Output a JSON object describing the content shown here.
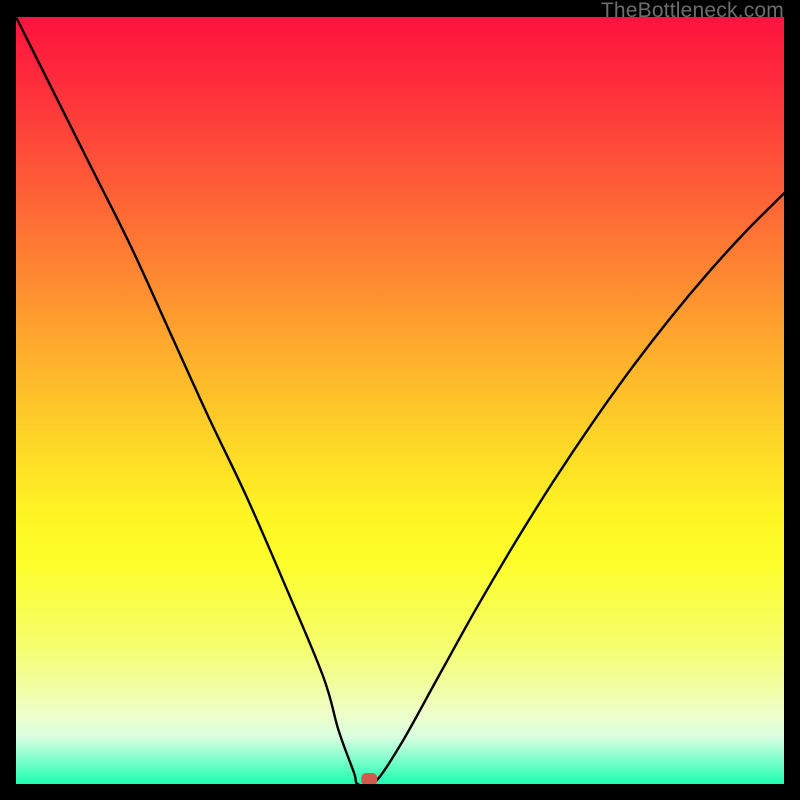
{
  "watermark": "TheBottleneck.com",
  "chart_data": {
    "type": "line",
    "title": "",
    "xlabel": "",
    "ylabel": "",
    "xlim": [
      0,
      100
    ],
    "ylim": [
      0,
      100
    ],
    "grid": false,
    "background": "rainbow-vertical-gradient",
    "series": [
      {
        "name": "bottleneck-curve",
        "color": "#000000",
        "x": [
          0,
          5,
          10,
          15,
          20,
          25,
          30,
          35,
          40,
          42,
          44,
          44.5,
          46.5,
          50,
          55,
          60,
          65,
          70,
          75,
          80,
          85,
          90,
          95,
          100
        ],
        "values": [
          100,
          90,
          80,
          70,
          59,
          48,
          37.5,
          26,
          14,
          7,
          1.5,
          0,
          0,
          5,
          14,
          23,
          31.5,
          39.5,
          47,
          54,
          60.5,
          66.5,
          72,
          77
        ]
      }
    ],
    "marker": {
      "name": "optimum-point",
      "x": 46,
      "y": 0,
      "color": "#d35a4a",
      "shape": "rounded-rect"
    }
  }
}
